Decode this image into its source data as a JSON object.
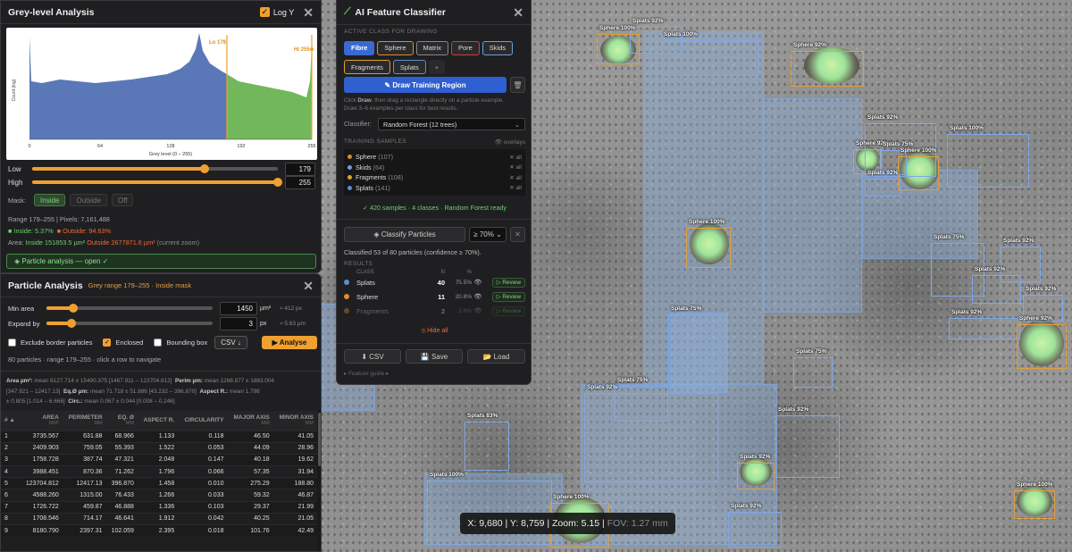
{
  "grey_level": {
    "title": "Grey-level Analysis",
    "logy_label": "Log Y",
    "lo_marker": "Lo 179",
    "hi_marker": "Hi 255",
    "yaxis_label": "Count (log)",
    "xaxis_label": "Grey level  (0 – 255)",
    "ticks": [
      "0",
      "64",
      "128",
      "192",
      "255"
    ],
    "low_label": "Low",
    "low_value": "179",
    "high_label": "High",
    "high_value": "255",
    "mask_label": "Mask:",
    "mask_options": [
      "Inside",
      "Outside",
      "Off"
    ],
    "range_text": "Range 179–255  |  Pixels: 7,161,488",
    "inside_text": "■ Inside: 5.37%",
    "outside_text": "■ Outside: 94.63%",
    "area_prefix": "Area:",
    "area_inside": "Inside 151853.5 µm²",
    "area_outside": "Outside 2677871.6 µm²",
    "area_suffix": "(current zoom)",
    "particle_btn": "◈ Particle analysis — open ✓",
    "accent_colors": {
      "blue_fill": "#5a78b8",
      "green_fill": "#72b85a",
      "orange": "#f0a030"
    }
  },
  "particle": {
    "title": "Particle Analysis",
    "subtitle": "Grey range 179–255 · Inside mask",
    "min_area_label": "Min area",
    "min_area_value": "1450",
    "min_area_unit": "µm²",
    "min_area_hint": "≈ 412 px",
    "expand_label": "Expand by",
    "expand_value": "3",
    "expand_unit": "px",
    "expand_hint": "≈ 5.63 µm",
    "exclude_label": "Exclude border particles",
    "enclosed_label": "Enclosed",
    "bbox_label": "Bounding box",
    "csv_label": "CSV ↓",
    "analyse_label": "▶ Analyse",
    "summary": "80 particles · range 179–255 · click a row to navigate",
    "stats_line1_a": "Area µm²:",
    "stats_line1_b": "mean 6127.714 ± 15490.375  [1467.911 – 123704.812]",
    "stats_line1_c": "Perim µm:",
    "stats_line1_d": "mean 1268.877 ± 1883.004",
    "stats_line2_a": "[347.921 – 12417.13]",
    "stats_line2_b": "Eq.Ø µm:",
    "stats_line2_c": "mean 71.718 ± 51.886  [43.232 – 396.870]",
    "stats_line2_d": "Aspect R.:",
    "stats_line2_e": "mean 1.798",
    "stats_line3_a": "± 0.805  [1.014 – 6.666]",
    "stats_line3_b": "Circ.:",
    "stats_line3_c": "mean 0.067 ± 0.044  [0.008 – 0.246]",
    "columns": [
      [
        "# ▲",
        ""
      ],
      [
        "AREA",
        "MM²"
      ],
      [
        "PERIMETER",
        "MM"
      ],
      [
        "EQ. Ø",
        "MM"
      ],
      [
        "ASPECT R.",
        ""
      ],
      [
        "CIRCULARITY",
        ""
      ],
      [
        "MAJOR AXIS",
        "MM"
      ],
      [
        "MINOR AXIS",
        "MM"
      ]
    ],
    "rows": [
      [
        "1",
        "3735.567",
        "631.88",
        "68.966",
        "1.133",
        "0.118",
        "46.50",
        "41.05"
      ],
      [
        "2",
        "2409.903",
        "759.05",
        "55.393",
        "1.522",
        "0.053",
        "44.09",
        "28.96"
      ],
      [
        "3",
        "1758.728",
        "387.74",
        "47.321",
        "2.048",
        "0.147",
        "40.18",
        "19.62"
      ],
      [
        "4",
        "3988.451",
        "870.36",
        "71.262",
        "1.796",
        "0.066",
        "57.35",
        "31.94"
      ],
      [
        "5",
        "123704.812",
        "12417.13",
        "396.870",
        "1.458",
        "0.010",
        "275.29",
        "188.80"
      ],
      [
        "6",
        "4588.260",
        "1315.00",
        "76.433",
        "1.266",
        "0.033",
        "59.32",
        "46.87"
      ],
      [
        "7",
        "1726.722",
        "459.87",
        "46.888",
        "1.336",
        "0.103",
        "29.37",
        "21.99"
      ],
      [
        "8",
        "1708.546",
        "714.17",
        "46.641",
        "1.912",
        "0.042",
        "40.25",
        "21.05"
      ],
      [
        "9",
        "8180.790",
        "2397.31",
        "102.059",
        "2.395",
        "0.018",
        "101.76",
        "42.49"
      ]
    ]
  },
  "ai": {
    "title": "AI Feature Classifier",
    "active_label": "ACTIVE CLASS FOR DRAWING",
    "classes": [
      {
        "name": "Fibre",
        "color": "#3a6ad0",
        "active": true
      },
      {
        "name": "Sphere",
        "color": "#e08a2a"
      },
      {
        "name": "Matrix",
        "color": "#888888"
      },
      {
        "name": "Pore",
        "color": "#d04030"
      },
      {
        "name": "Skids",
        "color": "#6aa0e0"
      },
      {
        "name": "Fragments",
        "color": "#e0a030"
      },
      {
        "name": "Splats",
        "color": "#5a90d0"
      }
    ],
    "add_label": "+",
    "draw_btn": "✎ Draw Training Region",
    "hint_a": "Click",
    "hint_b": "Draw",
    "hint_c": ", then drag a rectangle directly on a particle example.",
    "hint_2": "Draw 3–6 examples per class for best results.",
    "classifier_label": "Classifier:",
    "classifier_value": "Random Forest (12 trees)",
    "samples_label": "TRAINING SAMPLES",
    "overlays_label": "overlays",
    "samples": [
      {
        "name": "Sphere",
        "count": "(107)",
        "color": "#e08a2a"
      },
      {
        "name": "Skids",
        "count": "(64)",
        "color": "#6aa0e0"
      },
      {
        "name": "Fragments",
        "count": "(108)",
        "color": "#e0a030"
      },
      {
        "name": "Splats",
        "count": "(141)",
        "color": "#5a90d0"
      }
    ],
    "clear_all": "✕ all",
    "ready_text": "✓ 420 samples · 4 classes · Random Forest ready",
    "classify_btn": "◈ Classify Particles",
    "confidence": "≥ 70%",
    "classified_text": "Classified 53 of 80 particles (confidence ≥ 70%).",
    "results_label": "RESULTS",
    "res_headers": [
      "CLASS",
      "N",
      "%"
    ],
    "results": [
      {
        "name": "Splats",
        "n": "40",
        "pct": "75.5%",
        "color": "#5a90d0",
        "dim": false
      },
      {
        "name": "Sphere",
        "n": "11",
        "pct": "20.8%",
        "color": "#e08a2a",
        "dim": false
      },
      {
        "name": "Fragments",
        "n": "2",
        "pct": "3.8%",
        "color": "#e0a030",
        "dim": true
      }
    ],
    "review_label": "▷ Review",
    "hide_all": "⦸ Hide all",
    "csv_btn": "⬇ CSV",
    "save_btn": "💾 Save",
    "load_btn": "📂 Load",
    "guide": "▸ Feature guide ▸"
  },
  "viewer": {
    "coords_main": "X: 9,680 | Y: 8,759 | Zoom: 5.15 |",
    "coords_fov": "FOV: 1.27 mm"
  },
  "detections": [
    {
      "t": "Splats 92%"
    },
    {
      "t": "Splats 100%"
    },
    {
      "t": "Sphere 100%"
    },
    {
      "t": "Sphere 92%"
    },
    {
      "t": "Splats 92%"
    },
    {
      "t": "Splats 100%"
    },
    {
      "t": "Sphere 92%"
    },
    {
      "t": "Splats 75%"
    },
    {
      "t": "Sphere 100%"
    },
    {
      "t": "Splats 92%"
    },
    {
      "t": "Sphere 100%"
    },
    {
      "t": "Splats 75%"
    },
    {
      "t": "Splats 92%"
    },
    {
      "t": "Splats 92%"
    },
    {
      "t": "Splats 92%"
    },
    {
      "t": "Splats 92%"
    },
    {
      "t": "Sphere 92%"
    },
    {
      "t": "Splats 75%"
    },
    {
      "t": "Splats 75%"
    },
    {
      "t": "Splats 92%"
    },
    {
      "t": "Splats 75%"
    },
    {
      "t": "Splats 92%"
    },
    {
      "t": "Splats 83%"
    },
    {
      "t": "Splats 92%"
    },
    {
      "t": "Splats 100%"
    },
    {
      "t": "Sphere 100%"
    },
    {
      "t": "Splats 92%"
    },
    {
      "t": "Sphere 100%"
    }
  ]
}
